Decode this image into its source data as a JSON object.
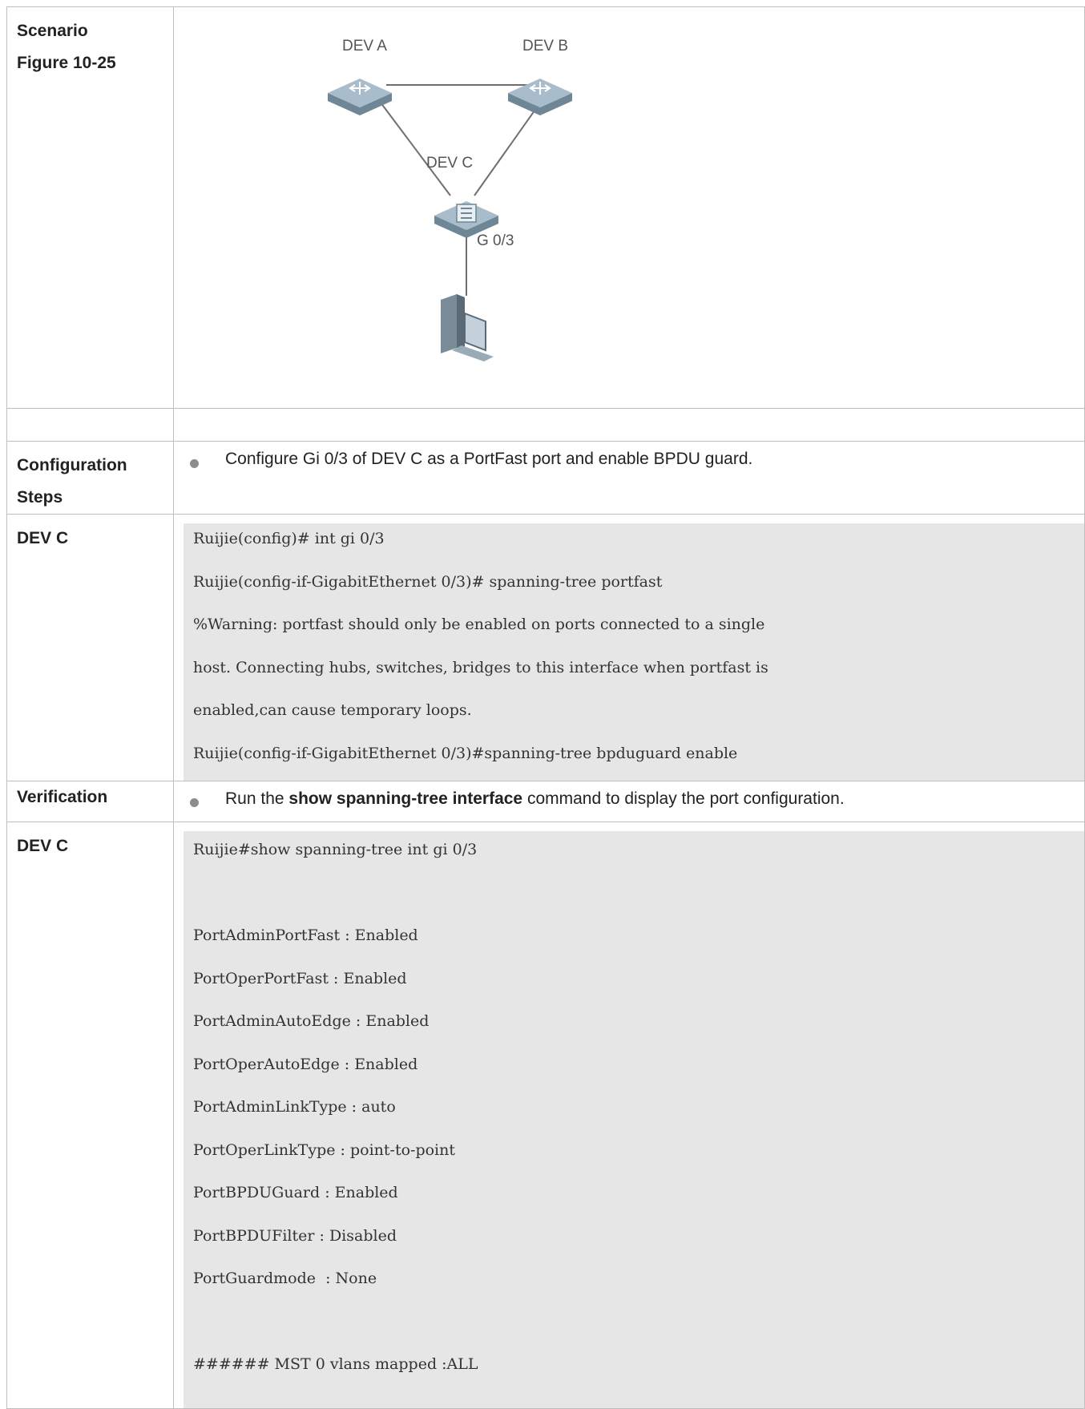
{
  "rows": {
    "scenario": {
      "label_line1": "Scenario",
      "label_line2": "Figure 10-25",
      "figure": {
        "dev_a": "DEV A",
        "dev_b": "DEV B",
        "dev_c": "DEV C",
        "port": "G 0/3"
      }
    },
    "config_steps": {
      "label_line1": "Configuration",
      "label_line2": "Steps",
      "bullet": "Configure Gi 0/3 of DEV C as a PortFast port and enable BPDU guard."
    },
    "config_device": {
      "label": "DEV C",
      "code": [
        "Ruijie(config)# int gi 0/3",
        "Ruijie(config-if-GigabitEthernet 0/3)# spanning-tree portfast",
        "%Warning: portfast should only be enabled on ports connected to a single",
        "host. Connecting hubs, switches, bridges to this interface when portfast is",
        "enabled,can cause temporary loops.",
        "Ruijie(config-if-GigabitEthernet 0/3)#spanning-tree bpduguard enable"
      ]
    },
    "verification": {
      "label": "Verification",
      "bullet_prefix": "Run the ",
      "bullet_bold": "show spanning-tree interface",
      "bullet_suffix": " command to display the port configuration."
    },
    "verify_device": {
      "label": "DEV C",
      "code": [
        "Ruijie#show spanning-tree int gi 0/3",
        "",
        "PortAdminPortFast : Enabled",
        "PortOperPortFast : Enabled",
        "PortAdminAutoEdge : Enabled",
        "PortOperAutoEdge : Enabled",
        "PortAdminLinkType : auto",
        "PortOperLinkType : point-to-point",
        "PortBPDUGuard : Enabled",
        "PortBPDUFilter : Disabled",
        "PortGuardmode  : None",
        "",
        "###### MST 0 vlans mapped :ALL"
      ]
    }
  }
}
